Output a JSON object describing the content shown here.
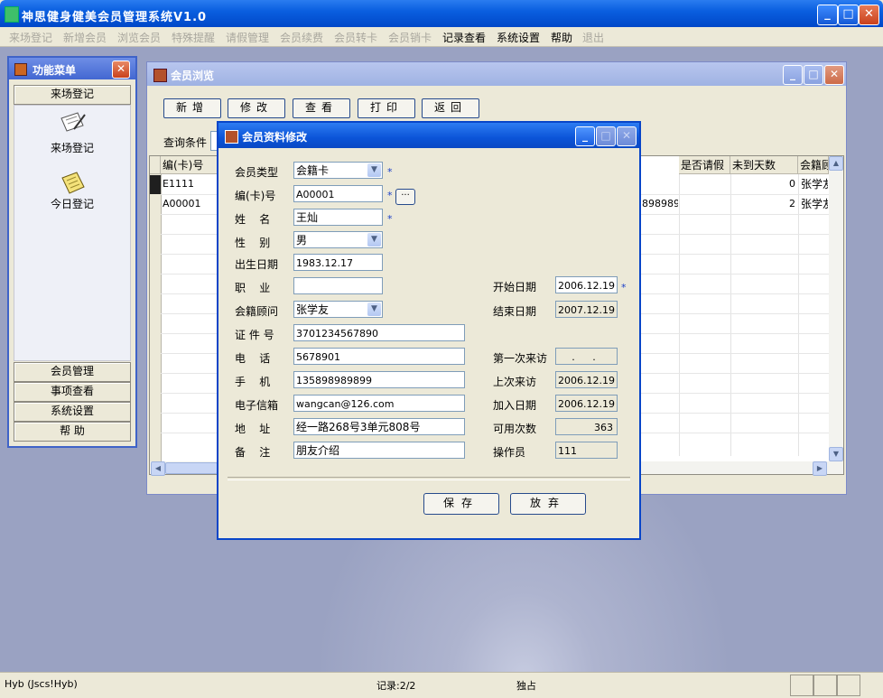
{
  "app": {
    "title": "神思健身健美会员管理系统V1.0",
    "min": "_",
    "max": "□",
    "close": "✕"
  },
  "menu": {
    "items": [
      {
        "label": "来场登记",
        "enabled": false
      },
      {
        "label": "新增会员",
        "enabled": false
      },
      {
        "label": "浏览会员",
        "enabled": false
      },
      {
        "label": "特殊提醒",
        "enabled": false
      },
      {
        "label": "请假管理",
        "enabled": false
      },
      {
        "label": "会员续费",
        "enabled": false
      },
      {
        "label": "会员转卡",
        "enabled": false
      },
      {
        "label": "会员销卡",
        "enabled": false
      },
      {
        "label": "记录查看",
        "enabled": true
      },
      {
        "label": "系统设置",
        "enabled": true
      },
      {
        "label": "帮助",
        "enabled": true
      },
      {
        "label": "退出",
        "enabled": false
      }
    ]
  },
  "func_menu": {
    "title": "功能菜单",
    "close": "✕",
    "top_button": "来场登记",
    "panel_items": [
      {
        "label": "来场登记",
        "icon": "pen-paper-icon"
      },
      {
        "label": "今日登记",
        "icon": "notepad-icon"
      }
    ],
    "bottom_buttons": [
      "会员管理",
      "事项查看",
      "系统设置",
      "帮  助"
    ]
  },
  "browse": {
    "title": "会员浏览",
    "toolbar": [
      "新增",
      "修改",
      "查看",
      "打印",
      "返回"
    ],
    "query_label": "查询条件",
    "columns_left": [
      "编(卡)号"
    ],
    "columns_right": [
      "是否请假",
      "未到天数",
      "会籍顾"
    ],
    "rows": [
      {
        "card": "E1111",
        "phone": "",
        "leave": "",
        "days": "0",
        "advisor": "张学友"
      },
      {
        "card": "A00001",
        "phone": "8989899",
        "leave": "",
        "days": "2",
        "advisor": "张学友"
      }
    ]
  },
  "dialog": {
    "title": "会员资料修改",
    "left_fields": [
      {
        "label": "会员类型",
        "value": "会籍卡",
        "type": "combo",
        "required": true
      },
      {
        "label": "编(卡)号",
        "value": "A00001",
        "type": "text",
        "required": true,
        "ellipsis": "···"
      },
      {
        "label": "姓    名",
        "value": "王灿",
        "type": "text",
        "required": true
      },
      {
        "label": "性    别",
        "value": "男",
        "type": "combo",
        "required": false
      },
      {
        "label": "出生日期",
        "value": "1983.12.17",
        "type": "text",
        "required": false
      },
      {
        "label": "职    业",
        "value": "",
        "type": "text",
        "required": false
      },
      {
        "label": "会籍顾问",
        "value": "张学友",
        "type": "combo",
        "required": false
      },
      {
        "label": "证 件 号",
        "value": "3701234567890",
        "type": "text",
        "required": false
      },
      {
        "label": "电    话",
        "value": "5678901",
        "type": "text",
        "required": false
      },
      {
        "label": "手    机",
        "value": "135898989899",
        "type": "text",
        "required": false
      },
      {
        "label": "电子信箱",
        "value": "wangcan@126.com",
        "type": "text",
        "required": false
      },
      {
        "label": "地    址",
        "value": "经一路268号3单元808号",
        "type": "text",
        "required": false
      },
      {
        "label": "备    注",
        "value": "朋友介绍",
        "type": "text",
        "required": false
      }
    ],
    "right_fields": [
      {
        "label": "开始日期",
        "value": "2006.12.19",
        "required": true
      },
      {
        "label": "结束日期",
        "value": "2007.12.19",
        "required": false
      },
      {
        "label": "第一次来访",
        "value": ". .",
        "required": false
      },
      {
        "label": "上次来访",
        "value": "2006.12.19",
        "required": false
      },
      {
        "label": "加入日期",
        "value": "2006.12.19",
        "required": false
      },
      {
        "label": "可用次数",
        "value": "363",
        "required": false
      },
      {
        "label": "操作员",
        "value": "111",
        "required": false
      }
    ],
    "required_mark": "*",
    "save": "保存",
    "cancel": "放弃"
  },
  "status": {
    "user": "Hyb (Jscs!Hyb)",
    "records": "记录:2/2",
    "mode": "独占"
  }
}
